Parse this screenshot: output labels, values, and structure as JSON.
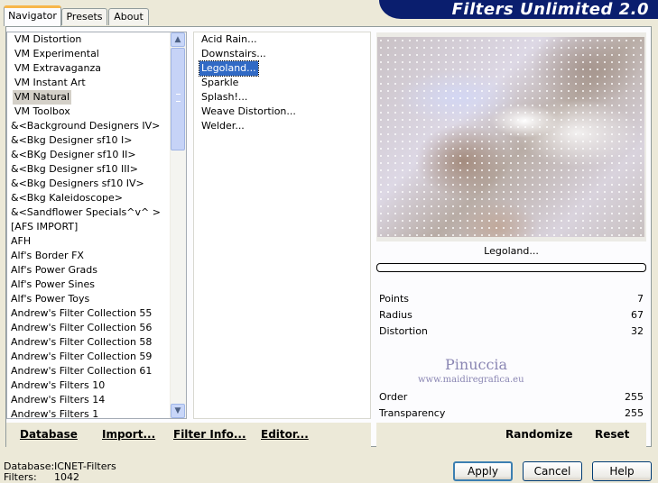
{
  "tabs": [
    {
      "label": "Navigator"
    },
    {
      "label": "Presets"
    },
    {
      "label": "About"
    }
  ],
  "app_title": "Filters Unlimited 2.0",
  "categories": [
    {
      "label": "VM Distortion"
    },
    {
      "label": "VM Experimental"
    },
    {
      "label": "VM Extravaganza"
    },
    {
      "label": "VM Instant Art"
    },
    {
      "label": "VM Natural"
    },
    {
      "label": "VM Toolbox"
    },
    {
      "label": "&<Background Designers IV>"
    },
    {
      "label": "&<Bkg Designer sf10 I>"
    },
    {
      "label": "&<BKg Designer sf10 II>"
    },
    {
      "label": "&<Bkg Designer sf10 III>"
    },
    {
      "label": "&<Bkg Designers sf10 IV>"
    },
    {
      "label": "&<Bkg Kaleidoscope>"
    },
    {
      "label": "&<Sandflower Specials^v^ >"
    },
    {
      "label": "[AFS IMPORT]"
    },
    {
      "label": "AFH"
    },
    {
      "label": "Alf's Border FX"
    },
    {
      "label": "Alf's Power Grads"
    },
    {
      "label": "Alf's Power Sines"
    },
    {
      "label": "Alf's Power Toys"
    },
    {
      "label": "Andrew's Filter Collection 55"
    },
    {
      "label": "Andrew's Filter Collection 56"
    },
    {
      "label": "Andrew's Filter Collection 58"
    },
    {
      "label": "Andrew's Filter Collection 59"
    },
    {
      "label": "Andrew's Filter Collection 61"
    },
    {
      "label": "Andrew's Filters 10"
    },
    {
      "label": "Andrew's Filters 14"
    },
    {
      "label": "Andrew's Filters 1"
    }
  ],
  "selected_category": "VM Natural",
  "filters": [
    {
      "label": "Acid Rain..."
    },
    {
      "label": "Downstairs..."
    },
    {
      "label": "Legoland..."
    },
    {
      "label": "Sparkle"
    },
    {
      "label": "Splash!..."
    },
    {
      "label": "Weave Distortion..."
    },
    {
      "label": "Welder..."
    }
  ],
  "selected_filter": "Legoland...",
  "preview": {
    "filter_name": "Legoland...",
    "progress": 0
  },
  "params": [
    {
      "label": "Points",
      "value": "7"
    },
    {
      "label": "Radius",
      "value": "67"
    },
    {
      "label": "Distortion",
      "value": "32"
    },
    {
      "label": "Order",
      "value": "255"
    },
    {
      "label": "Transparency",
      "value": "255"
    }
  ],
  "watermark": {
    "name": "Pinuccia",
    "site": "www.maidiregrafica.eu"
  },
  "bottom_left": {
    "database": "Database",
    "import": "Import...",
    "filter_info": "Filter Info...",
    "editor": "Editor..."
  },
  "bottom_right": {
    "randomize": "Randomize",
    "reset": "Reset"
  },
  "status": {
    "database_label": "Database:",
    "database_value": "ICNET-Filters",
    "filters_label": "Filters:",
    "filters_value": "1042"
  },
  "buttons": {
    "apply": "Apply",
    "cancel": "Cancel",
    "help": "Help"
  }
}
